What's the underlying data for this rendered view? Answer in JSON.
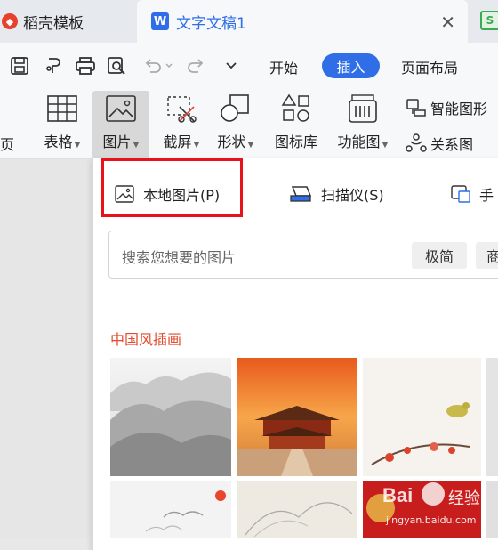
{
  "tabs": {
    "tab1_label": "稻壳模板",
    "tab2_label": "文字文稿1",
    "tab2_icon_letter": "W",
    "tab2_close": "✕",
    "tab3_letter": "S"
  },
  "menu": {
    "start": "开始",
    "insert": "插入",
    "page_layout": "页面布局"
  },
  "ribbon": {
    "cut_off_left": "页",
    "table": "表格",
    "picture": "图片",
    "screenshot": "截屏",
    "shape": "形状",
    "icon_lib": "图标库",
    "function_chart": "功能图",
    "smart_graphic": "智能图形",
    "relation_chart": "关系图"
  },
  "panel": {
    "local_picture": "本地图片(P)",
    "scanner": "扫描仪(S)",
    "phone": "手",
    "search_placeholder": "搜索您想要的图片",
    "chip1": "极简",
    "chip2": "商",
    "section_title": "中国风插画"
  },
  "watermark": {
    "brand": "Bai",
    "brand2": "经验",
    "url": "jingyan.baidu.com"
  },
  "colors": {
    "accent": "#2f6ee6",
    "highlight_border": "#e8121a",
    "section_title": "#e44b2e"
  }
}
